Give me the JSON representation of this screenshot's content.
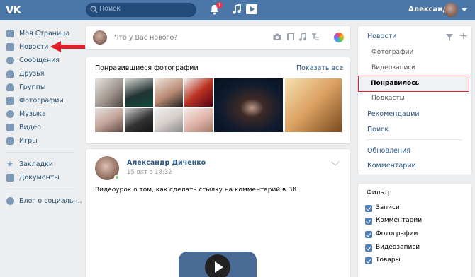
{
  "header": {
    "logo": "VK",
    "search_placeholder": "Поиск",
    "notifications_count": "1",
    "user_name": "Александр",
    "accent": "#4a76a8"
  },
  "nav": {
    "items": [
      {
        "label": "Моя Страница",
        "icon": "user-icon"
      },
      {
        "label": "Новости",
        "icon": "news-icon"
      },
      {
        "label": "Сообщения",
        "icon": "messages-icon"
      },
      {
        "label": "Друзья",
        "icon": "friends-icon"
      },
      {
        "label": "Группы",
        "icon": "groups-icon"
      },
      {
        "label": "Фотографии",
        "icon": "camera-icon"
      },
      {
        "label": "Музыка",
        "icon": "music-icon"
      },
      {
        "label": "Видео",
        "icon": "video-icon"
      },
      {
        "label": "Игры",
        "icon": "games-icon"
      }
    ],
    "secondary": [
      {
        "label": "Закладки",
        "icon": "star-icon"
      },
      {
        "label": "Документы",
        "icon": "document-icon"
      }
    ],
    "tertiary": [
      {
        "label": "Блог о социальн..",
        "icon": "blog-icon"
      }
    ]
  },
  "composer": {
    "placeholder": "Что у Вас нового?"
  },
  "liked_photos": {
    "title": "Понравившиеся фотографии",
    "show_all": "Показать все"
  },
  "post": {
    "author": "Александр Диченко",
    "date": "15 окт в 18:32",
    "text": "Видеоурок о том, как сделать ссылку на комментарий в ВК"
  },
  "menu": {
    "header": "Новости",
    "sub_items": [
      "Фотографии",
      "Видеозаписи"
    ],
    "active": "Понравилось",
    "after_active": "Подкасты",
    "top_items": [
      "Рекомендации",
      "Поиск"
    ],
    "bottom_items": [
      "Обновления",
      "Комментарии"
    ]
  },
  "filter": {
    "title": "Фильтр",
    "options": [
      {
        "label": "Записи",
        "checked": true
      },
      {
        "label": "Комментарии",
        "checked": true
      },
      {
        "label": "Фотографии",
        "checked": true
      },
      {
        "label": "Видеозаписи",
        "checked": true
      },
      {
        "label": "Товары",
        "checked": true
      }
    ]
  }
}
